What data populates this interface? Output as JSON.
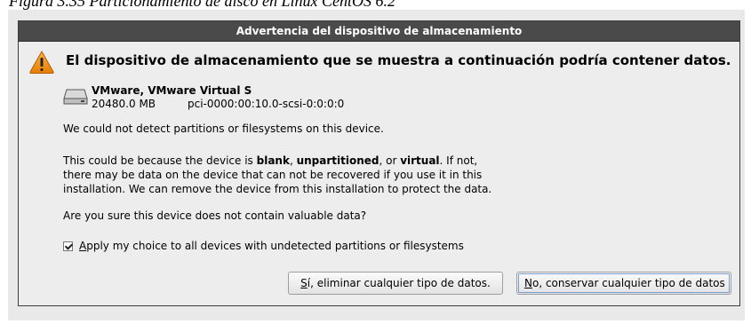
{
  "caption": "Figura 3.35 Particionamiento de disco en Linux CentOS 6.2",
  "dialog": {
    "title": "Advertencia del dispositivo de almacenamiento",
    "headline": "El dispositivo de almacenamiento que se muestra a continuación podría contener datos.",
    "warning_icon": "warning-triangle-icon",
    "device": {
      "icon": "hard-drive-icon",
      "name": "VMware, VMware Virtual S",
      "size": "20480.0 MB",
      "path": "pci-0000:00:10.0-scsi-0:0:0:0"
    },
    "paragraph1": "We could not detect partitions or filesystems on this device.",
    "paragraph2": {
      "before": "This could be because the device is ",
      "blank": "blank",
      "comma1": ", ",
      "unpartitioned": "unpartitioned",
      "or": ", or ",
      "virtual": "virtual",
      "after_line1": ". If not,",
      "line2": "there may be data on the device that can not be recovered if you use it in this",
      "line3": "installation. We can remove the device from this installation to protect the data."
    },
    "paragraph3": "Are you sure this device does not contain valuable data?",
    "apply_checkbox": {
      "checked": true,
      "accel": "A",
      "label_rest": "pply my choice to all devices with undetected partitions or filesystems"
    },
    "buttons": {
      "yes_accel": "S",
      "yes_rest": "í, eliminar cualquier tipo de datos.",
      "no_accel": "N",
      "no_rest": "o, conservar cualquier tipo de datos"
    }
  }
}
